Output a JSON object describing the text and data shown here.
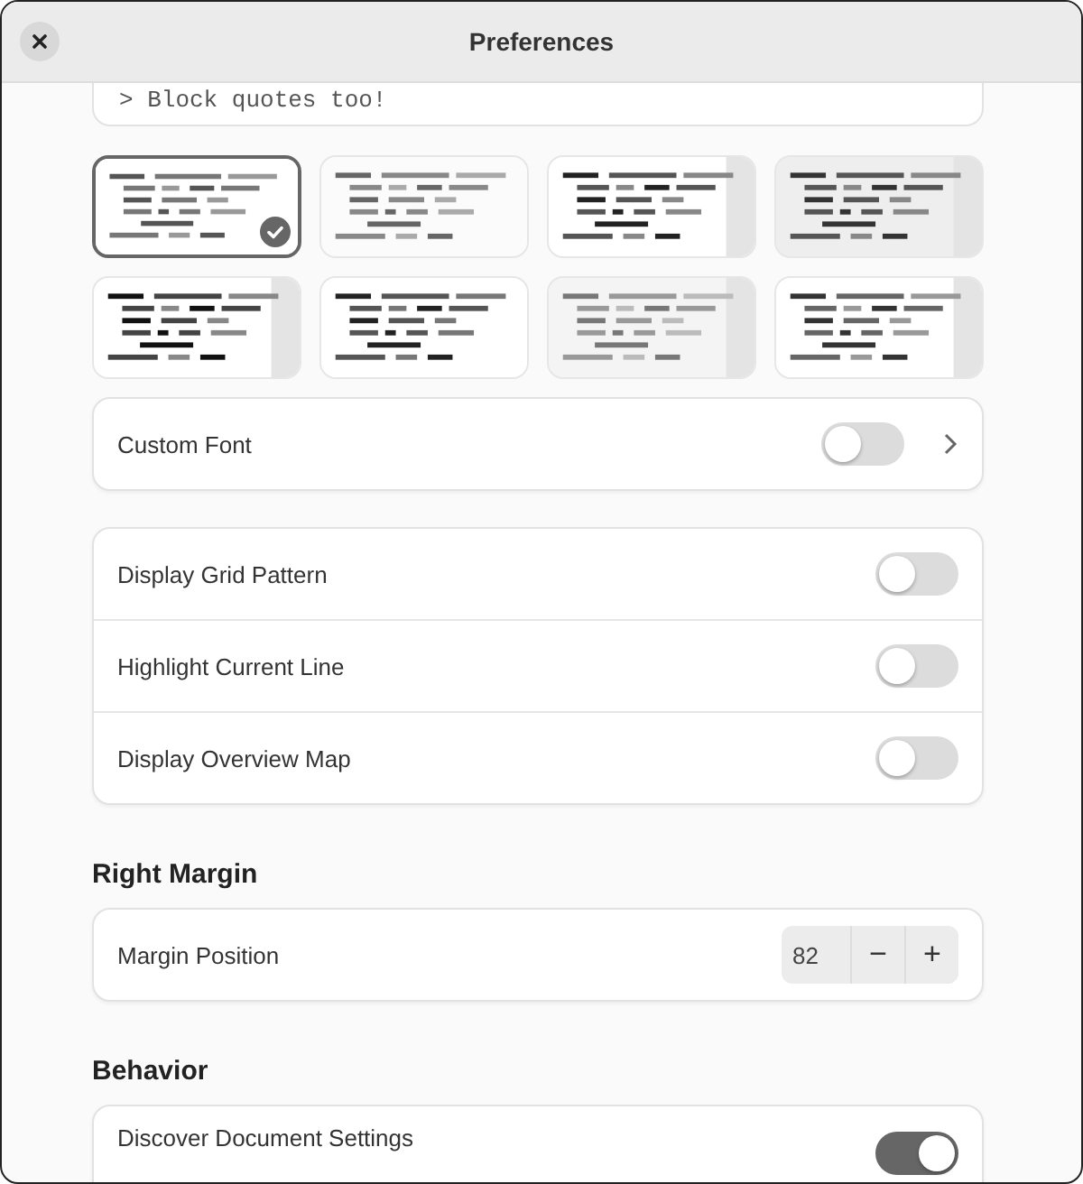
{
  "window": {
    "title": "Preferences"
  },
  "preview": {
    "text": "> Block quotes too!"
  },
  "schemes": [
    {
      "selected": true
    },
    {
      "selected": false
    },
    {
      "selected": false
    },
    {
      "selected": false
    },
    {
      "selected": false
    },
    {
      "selected": false
    },
    {
      "selected": false
    },
    {
      "selected": false
    }
  ],
  "custom_font": {
    "label": "Custom Font",
    "on": false
  },
  "display_options": [
    {
      "label": "Display Grid Pattern",
      "on": false
    },
    {
      "label": "Highlight Current Line",
      "on": false
    },
    {
      "label": "Display Overview Map",
      "on": false
    }
  ],
  "right_margin": {
    "heading": "Right Margin",
    "label": "Margin Position",
    "value": "82",
    "decrement": "−",
    "increment": "+"
  },
  "behavior": {
    "heading": "Behavior",
    "rows": [
      {
        "label": "Discover Document Settings",
        "on": true
      }
    ]
  }
}
